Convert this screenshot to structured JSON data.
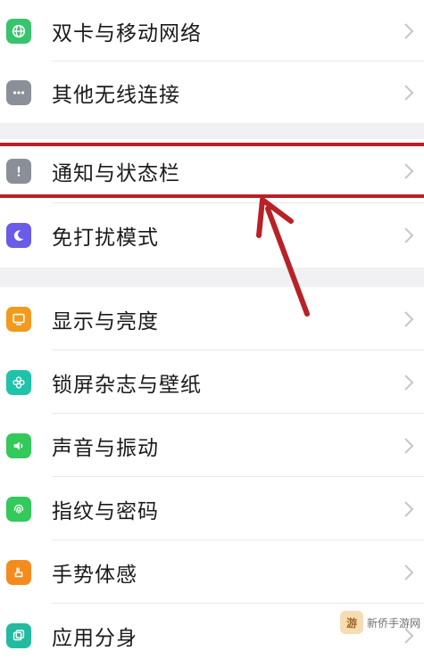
{
  "settings": {
    "group1": [
      {
        "label": "双卡与移动网络",
        "icon": "globe-icon",
        "color": "#37c46c"
      },
      {
        "label": "其他无线连接",
        "icon": "more-dots-icon",
        "color": "#8a8f99"
      }
    ],
    "group2": [
      {
        "label": "通知与状态栏",
        "icon": "exclamation-icon",
        "color": "#8a8f99"
      },
      {
        "label": "免打扰模式",
        "icon": "moon-icon",
        "color": "#6a5ce8"
      }
    ],
    "group3": [
      {
        "label": "显示与亮度",
        "icon": "monitor-icon",
        "color": "#f19a1e"
      },
      {
        "label": "锁屏杂志与壁纸",
        "icon": "flower-icon",
        "color": "#1fc3a9"
      },
      {
        "label": "声音与振动",
        "icon": "speaker-icon",
        "color": "#34c95b"
      },
      {
        "label": "指纹与密码",
        "icon": "fingerprint-icon",
        "color": "#34c95b"
      },
      {
        "label": "手势体感",
        "icon": "hand-icon",
        "color": "#f58b1f"
      },
      {
        "label": "应用分身",
        "icon": "clone-icon",
        "color": "#22bba0"
      }
    ]
  },
  "annotation": {
    "highlight_color": "#b82126",
    "arrow_color": "#b82126"
  },
  "watermark": {
    "text": "新侨手游网"
  }
}
